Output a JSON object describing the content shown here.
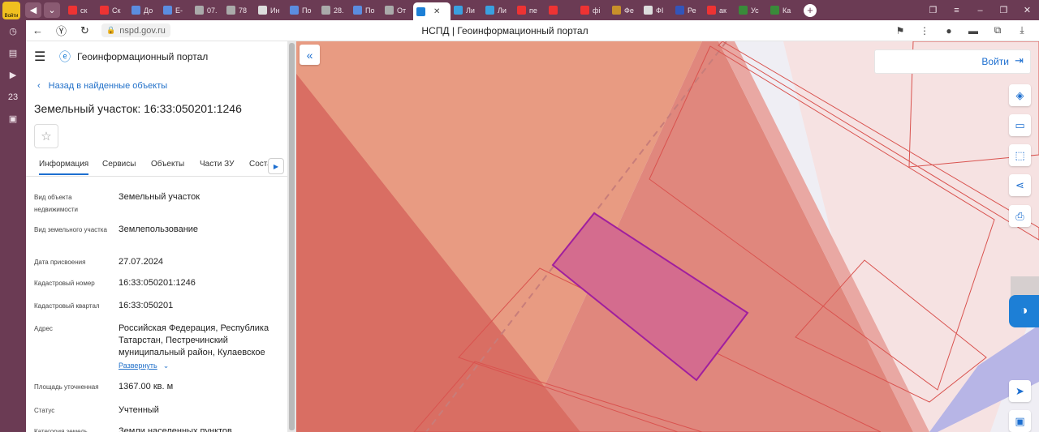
{
  "browser": {
    "lead_badge": "Войти",
    "tabs": [
      {
        "label": "ск",
        "color": "#e33"
      },
      {
        "label": "Ск",
        "color": "#e33"
      },
      {
        "label": "До",
        "color": "#5b8de0"
      },
      {
        "label": "Е-",
        "color": "#5b8de0"
      },
      {
        "label": "07.",
        "color": "#aaa"
      },
      {
        "label": "78",
        "color": "#aaa"
      },
      {
        "label": "Ин",
        "color": "#ddd"
      },
      {
        "label": "По",
        "color": "#5b8de0"
      },
      {
        "label": "28.",
        "color": "#aaa"
      },
      {
        "label": "По",
        "color": "#5b8de0"
      },
      {
        "label": "От",
        "color": "#aaa"
      },
      {
        "label": "",
        "color": "#1d7fd6",
        "active": true
      },
      {
        "label": "Ли",
        "color": "#3aa0e0"
      },
      {
        "label": "Ли",
        "color": "#3aa0e0"
      },
      {
        "label": "пе",
        "color": "#e33"
      },
      {
        "label": "",
        "color": "#e33"
      },
      {
        "label": "фі",
        "color": "#e33"
      },
      {
        "label": "Фе",
        "color": "#c8902a"
      },
      {
        "label": "ФІ",
        "color": "#ddd"
      },
      {
        "label": "Ре",
        "color": "#3355bb"
      },
      {
        "label": "ак",
        "color": "#e33"
      },
      {
        "label": "Ус",
        "color": "#3a8a3a"
      },
      {
        "label": "Ка",
        "color": "#3a8a3a"
      }
    ],
    "url": "nspd.gov.ru",
    "page_title": "НСПД | Геоинформационный портал",
    "rail_items": [
      "clock-icon",
      "notes-icon",
      "play-icon",
      "calendar-icon",
      "cards-icon"
    ],
    "rail_calendar": "23"
  },
  "panel": {
    "portal_title": "Геоинформационный портал",
    "back_link": "Назад в найденные объекты",
    "object_title": "Земельный участок: 16:33:050201:1246",
    "tabs": [
      "Информация",
      "Сервисы",
      "Объекты",
      "Части ЗУ",
      "Состав"
    ],
    "fields": [
      {
        "key": "Вид объекта недвижимости",
        "value": "Земельный участок"
      },
      {
        "key": "Вид земельного участка",
        "value": "Землепользование"
      },
      {
        "key": "Дата присвоения",
        "value": "27.07.2024"
      },
      {
        "key": "Кадастровый номер",
        "value": "16:33:050201:1246"
      },
      {
        "key": "Кадастровый квартал",
        "value": "16:33:050201"
      },
      {
        "key": "Адрес",
        "value": "Российская Федерация, Республика Татарстан, Пестречинский муниципальный район, Кулаевское"
      },
      {
        "key": "Площадь уточненная",
        "value": "1367.00 кв. м"
      },
      {
        "key": "Статус",
        "value": "Учтенный"
      },
      {
        "key": "Категория земель",
        "value": "Земли населенных пунктов"
      }
    ],
    "expand_label": "Развернуть"
  },
  "map": {
    "login_label": "Войти",
    "controls": [
      "layers-icon",
      "ruler-icon",
      "select-area-icon",
      "share-icon",
      "print-icon"
    ],
    "bottom_controls": [
      "locate-icon",
      "minimap-icon"
    ]
  }
}
